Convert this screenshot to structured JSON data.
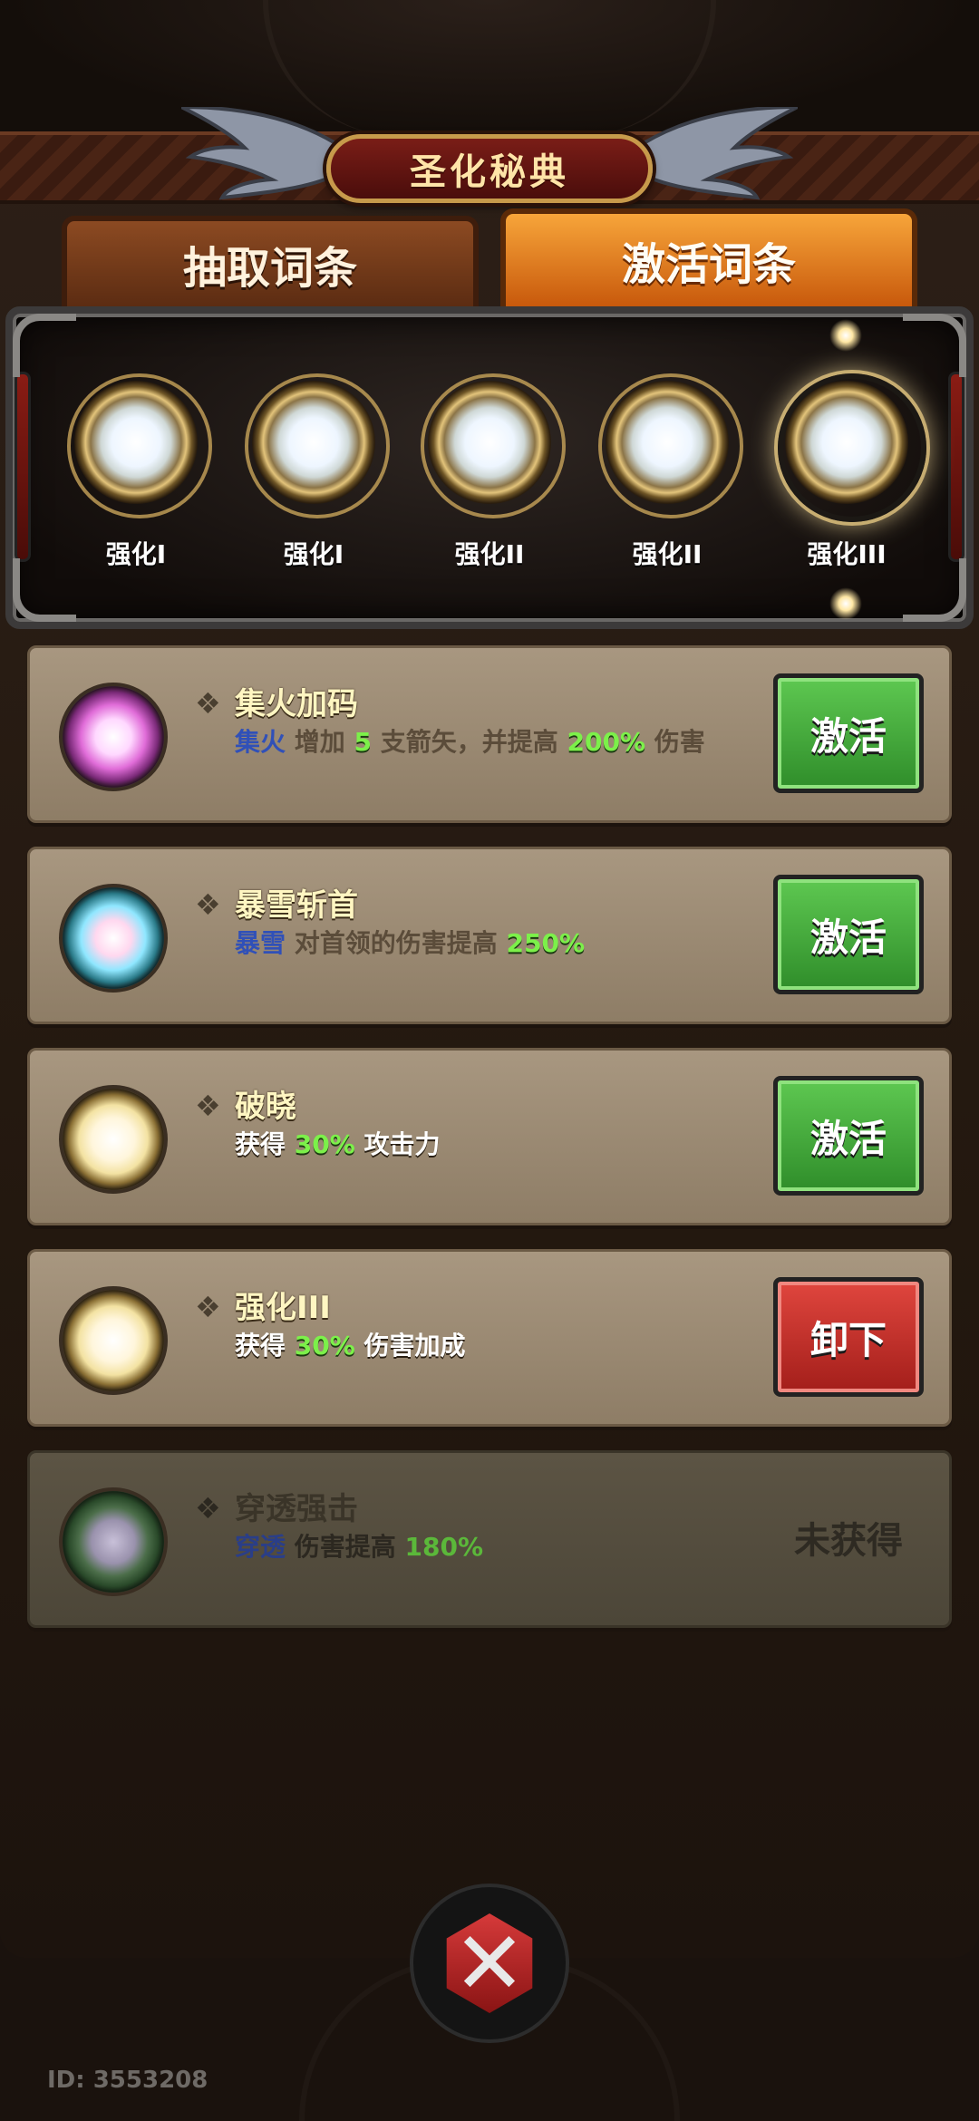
{
  "header": {
    "title": "圣化秘典"
  },
  "tabs": [
    {
      "label": "抽取词条",
      "active": false
    },
    {
      "label": "激活词条",
      "active": true
    }
  ],
  "slots": [
    {
      "label": "强化I",
      "icon": "light-orb-icon"
    },
    {
      "label": "强化I",
      "icon": "light-orb-icon"
    },
    {
      "label": "强化II",
      "icon": "light-orb-icon"
    },
    {
      "label": "强化II",
      "icon": "light-orb-icon"
    },
    {
      "label": "强化III",
      "icon": "light-orb-icon",
      "selected": true
    }
  ],
  "cards": [
    {
      "title": "集火加码",
      "desc": {
        "kw": "集火",
        "t1": "增加",
        "n1": "5",
        "t2": "支箭矢，并提高",
        "n2": "200%",
        "t3": "伤害"
      },
      "button": "激活",
      "orb_color": "#e06cd8"
    },
    {
      "title": "暴雪斩首",
      "desc": {
        "kw": "暴雪",
        "t1": "对首领的伤害提高",
        "n1": "250%"
      },
      "button": "激活",
      "orb_color": "#8fe7ff"
    },
    {
      "title": "破晓",
      "desc": {
        "t1": "获得",
        "n1": "30%",
        "t2": "攻击力"
      },
      "button": "激活",
      "orb_color": "#f3e2a2"
    },
    {
      "title": "强化III",
      "desc": {
        "t1": "获得",
        "n1": "30%",
        "t2": "伤害加成"
      },
      "button": "卸下",
      "orb_color": "#f3e2a2"
    },
    {
      "title": "穿透强击",
      "desc": {
        "kw": "穿透",
        "t1": "伤害提高",
        "n1": "180%"
      },
      "status": "未获得",
      "orb_color": "#4c6e4a"
    }
  ],
  "footer": {
    "id_text": "ID: 3553208"
  },
  "colors": {
    "activate_button": "#3fa336",
    "unequip_button": "#c2302a",
    "active_tab": "#e77d20",
    "highlight_number": "#7cf04a",
    "keyword": "#3050b8"
  }
}
